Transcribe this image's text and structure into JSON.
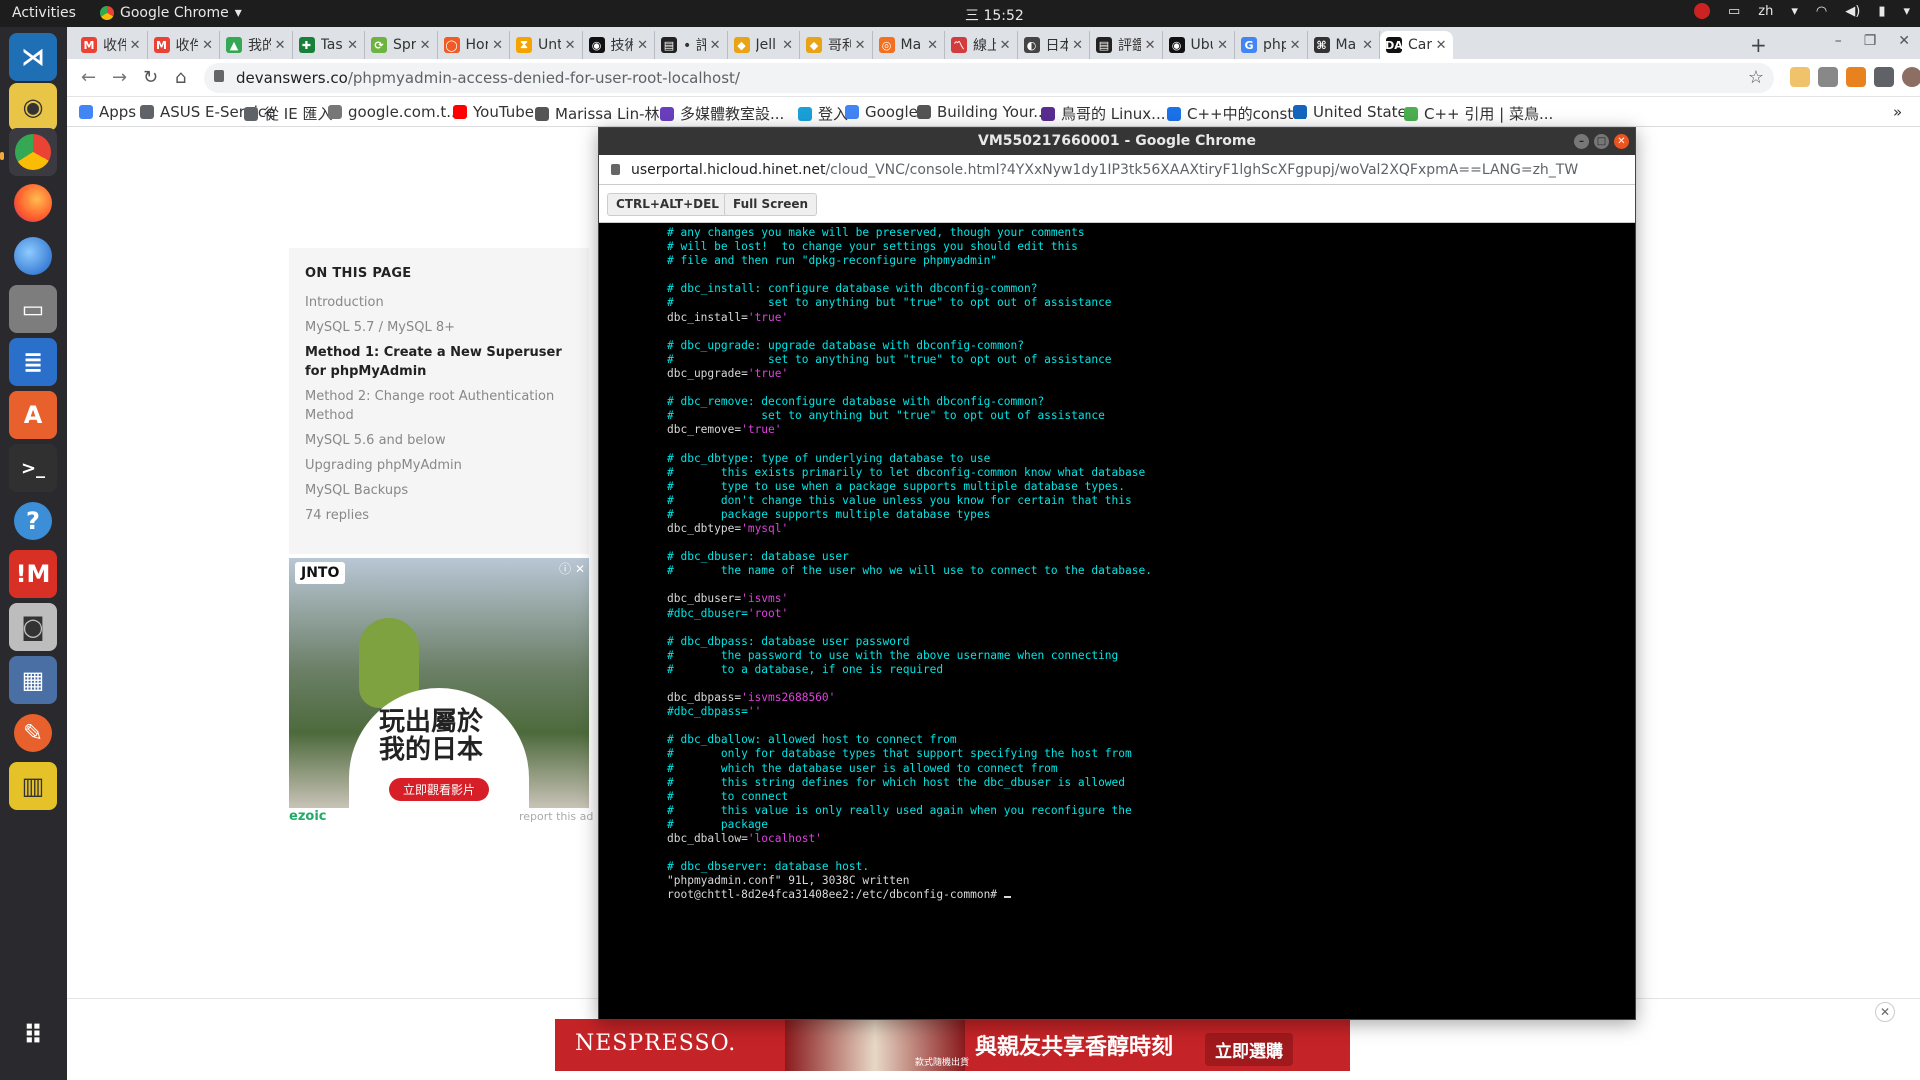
{
  "topbar": {
    "activities": "Activities",
    "app_name": "Google Chrome",
    "clock": "三 15:52",
    "lang": "zh"
  },
  "tabs": [
    {
      "title": "收件",
      "color": "#ea4335",
      "glyph": "M"
    },
    {
      "title": "收件",
      "color": "#ea4335",
      "glyph": "M"
    },
    {
      "title": "我的",
      "color": "#34a853",
      "glyph": "▲"
    },
    {
      "title": "Tas",
      "color": "#188038",
      "glyph": "✚"
    },
    {
      "title": "Spr",
      "color": "#6db33f",
      "glyph": "⟳"
    },
    {
      "title": "Hor",
      "color": "#f15a24",
      "glyph": "◯"
    },
    {
      "title": "Unt",
      "color": "#f4a300",
      "glyph": "⧗"
    },
    {
      "title": "技術",
      "color": "#111111",
      "glyph": "◉"
    },
    {
      "title": "• 評",
      "color": "#222222",
      "glyph": "▤"
    },
    {
      "title": "Jell",
      "color": "#e8a317",
      "glyph": "◆"
    },
    {
      "title": "哥利",
      "color": "#e8a317",
      "glyph": "◆"
    },
    {
      "title": "Ma",
      "color": "#f37021",
      "glyph": "◎"
    },
    {
      "title": "線上",
      "color": "#d23c3c",
      "glyph": "〽"
    },
    {
      "title": "日本",
      "color": "#444444",
      "glyph": "◐"
    },
    {
      "title": "評鑑",
      "color": "#222222",
      "glyph": "▤"
    },
    {
      "title": "Ubu",
      "color": "#111111",
      "glyph": "◉"
    },
    {
      "title": "php",
      "color": "#4285f4",
      "glyph": "G"
    },
    {
      "title": "Ma",
      "color": "#333333",
      "glyph": "⌘"
    },
    {
      "title": "Car",
      "color": "#111111",
      "glyph": "DA",
      "active": true
    }
  ],
  "omnibox": {
    "domain": "devanswers.co",
    "path": "/phpmyadmin-access-denied-for-user-root-localhost/"
  },
  "bookmarks": [
    {
      "label": "Apps",
      "color": "#4285f4"
    },
    {
      "label": "ASUS E-Service",
      "color": "#5f6368"
    },
    {
      "label": "從 IE 匯入",
      "color": "#5f6368"
    },
    {
      "label": "google.com.t...",
      "color": "#777777"
    },
    {
      "label": "YouTube",
      "color": "#ff0000"
    },
    {
      "label": "Marissa Lin-林...",
      "color": "#555555"
    },
    {
      "label": "多媒體教室設...",
      "color": "#6a3fbf"
    },
    {
      "label": "登入",
      "color": "#1aa1d8"
    },
    {
      "label": "Google",
      "color": "#4285f4"
    },
    {
      "label": "Building Your...",
      "color": "#555555"
    },
    {
      "label": "鳥哥的 Linux...",
      "color": "#5a2d91"
    },
    {
      "label": "C++中的const...",
      "color": "#1a73e8"
    },
    {
      "label": "United States",
      "color": "#1565c0"
    },
    {
      "label": "C++ 引用 | 菜鳥...",
      "color": "#4caf50"
    }
  ],
  "toc": {
    "title": "ON THIS PAGE",
    "items": [
      {
        "label": "Introduction",
        "bold": false
      },
      {
        "label": "MySQL 5.7 / MySQL 8+",
        "bold": false
      },
      {
        "label": "Method 1: Create a New Superuser for phpMyAdmin",
        "bold": true
      },
      {
        "label": "Method 2: Change root Authentication Method",
        "bold": false
      },
      {
        "label": "MySQL 5.6 and below",
        "bold": false
      },
      {
        "label": "Upgrading phpMyAdmin",
        "bold": false
      },
      {
        "label": "MySQL Backups",
        "bold": false
      },
      {
        "label": "74 replies",
        "bold": false
      }
    ]
  },
  "ad_jnto": {
    "logo": "JNTO",
    "slogan": "玩出屬於\n我的日本",
    "cta": "立即觀看影片",
    "brand_footer": "ezoic",
    "report": "report this ad"
  },
  "ad_nespresso": {
    "brand": "NESPRESSO.",
    "tagline": "與親友共享香醇時刻",
    "small": "款式隨機出貨",
    "cta": "立即選購"
  },
  "vnc": {
    "title": "VM550217660001 - Google Chrome",
    "url_domain": "userportal.hicloud.hinet.net",
    "url_path": "/cloud_VNC/console.html?4YXxNyw1dy1IP3tk56XAAXtiryF1lghScXFgpupj/woVal2XQFxpmA==LANG=zh_TW",
    "btn_cad": "CTRL+ALT+DEL",
    "btn_full": "Full Screen",
    "terminal_lines": [
      [
        {
          "t": "# any changes you make will be preserved, though your comments",
          "c": "c"
        }
      ],
      [
        {
          "t": "# will be lost!  to change your settings you should edit this",
          "c": "c"
        }
      ],
      [
        {
          "t": "# file and then run \"dpkg-reconfigure phpmyadmin\"",
          "c": "c"
        }
      ],
      [],
      [
        {
          "t": "# dbc_install: configure database with dbconfig-common?",
          "c": "c"
        }
      ],
      [
        {
          "t": "#              set to anything but \"true\" to opt out of assistance",
          "c": "c"
        }
      ],
      [
        {
          "t": "dbc_install=",
          "c": "w"
        },
        {
          "t": "'true'",
          "c": "m"
        }
      ],
      [],
      [
        {
          "t": "# dbc_upgrade: upgrade database with dbconfig-common?",
          "c": "c"
        }
      ],
      [
        {
          "t": "#              set to anything but \"true\" to opt out of assistance",
          "c": "c"
        }
      ],
      [
        {
          "t": "dbc_upgrade=",
          "c": "w"
        },
        {
          "t": "'true'",
          "c": "m"
        }
      ],
      [],
      [
        {
          "t": "# dbc_remove: deconfigure database with dbconfig-common?",
          "c": "c"
        }
      ],
      [
        {
          "t": "#             set to anything but \"true\" to opt out of assistance",
          "c": "c"
        }
      ],
      [
        {
          "t": "dbc_remove=",
          "c": "w"
        },
        {
          "t": "'true'",
          "c": "m"
        }
      ],
      [],
      [
        {
          "t": "# dbc_dbtype: type of underlying database to use",
          "c": "c"
        }
      ],
      [
        {
          "t": "#       this exists primarily to let dbconfig-common know what database",
          "c": "c"
        }
      ],
      [
        {
          "t": "#       type to use when a package supports multiple database types.",
          "c": "c"
        }
      ],
      [
        {
          "t": "#       don't change this value unless you know for certain that this",
          "c": "c"
        }
      ],
      [
        {
          "t": "#       package supports multiple database types",
          "c": "c"
        }
      ],
      [
        {
          "t": "dbc_dbtype=",
          "c": "w"
        },
        {
          "t": "'mysql'",
          "c": "m"
        }
      ],
      [],
      [
        {
          "t": "# dbc_dbuser: database user",
          "c": "c"
        }
      ],
      [
        {
          "t": "#       the name of the user who we will use to connect to the database.",
          "c": "c"
        }
      ],
      [],
      [
        {
          "t": "dbc_dbuser=",
          "c": "w"
        },
        {
          "t": "'isvms'",
          "c": "m"
        }
      ],
      [
        {
          "t": "#dbc_dbuser=",
          "c": "c"
        },
        {
          "t": "'root'",
          "c": "m"
        }
      ],
      [],
      [
        {
          "t": "# dbc_dbpass: database user password",
          "c": "c"
        }
      ],
      [
        {
          "t": "#       the password to use with the above username when connecting",
          "c": "c"
        }
      ],
      [
        {
          "t": "#       to a database, if one is required",
          "c": "c"
        }
      ],
      [],
      [
        {
          "t": "dbc_dbpass=",
          "c": "w"
        },
        {
          "t": "'isvms2688560'",
          "c": "m"
        }
      ],
      [
        {
          "t": "#dbc_dbpass=",
          "c": "c"
        },
        {
          "t": "''",
          "c": "m"
        }
      ],
      [],
      [
        {
          "t": "# dbc_dballow: allowed host to connect from",
          "c": "c"
        }
      ],
      [
        {
          "t": "#       only for database types that support specifying the host from",
          "c": "c"
        }
      ],
      [
        {
          "t": "#       which the database user is allowed to connect from",
          "c": "c"
        }
      ],
      [
        {
          "t": "#       this string defines for which host the dbc_dbuser is allowed",
          "c": "c"
        }
      ],
      [
        {
          "t": "#       to connect",
          "c": "c"
        }
      ],
      [
        {
          "t": "#       this value is only really used again when you reconfigure the",
          "c": "c"
        }
      ],
      [
        {
          "t": "#       package",
          "c": "c"
        }
      ],
      [
        {
          "t": "dbc_dballow=",
          "c": "w"
        },
        {
          "t": "'localhost'",
          "c": "m"
        }
      ],
      [],
      [
        {
          "t": "# dbc_dbserver: database host.",
          "c": "c"
        }
      ],
      [
        {
          "t": "\"phpmyadmin.conf\" 91L, 3038C written",
          "c": "w"
        }
      ],
      [
        {
          "t": "root@chttl-8d2e4fca31408ee2:/etc/dbconfig-common# ",
          "c": "w"
        },
        {
          "t": "",
          "c": "cursor"
        }
      ]
    ]
  },
  "colors": {
    "dock_bg": "#2a2a2e",
    "topbar_bg": "#1d1d1d",
    "terminal_cyan": "#00e5e5",
    "terminal_magenta": "#e040e0"
  }
}
